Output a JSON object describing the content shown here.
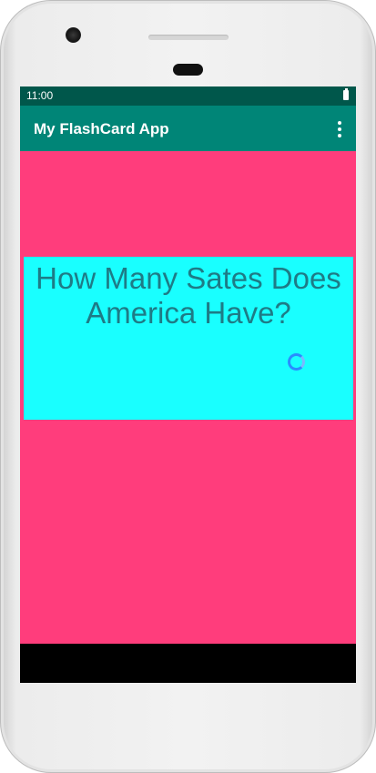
{
  "status_bar": {
    "time": "11:00",
    "battery_icon": "battery-full-icon"
  },
  "app_bar": {
    "title": "My FlashCard App",
    "overflow_icon": "more-vert-icon"
  },
  "flashcard": {
    "question": "How Many Sates Does America Have?"
  },
  "fab": {
    "icon": "mail-icon"
  },
  "colors": {
    "status_bar": "#00574b",
    "app_bar": "#008577",
    "background": "#ff3d7c",
    "card": "#19ffff",
    "question_text": "#1e7b86",
    "fab": "#d81b60"
  }
}
